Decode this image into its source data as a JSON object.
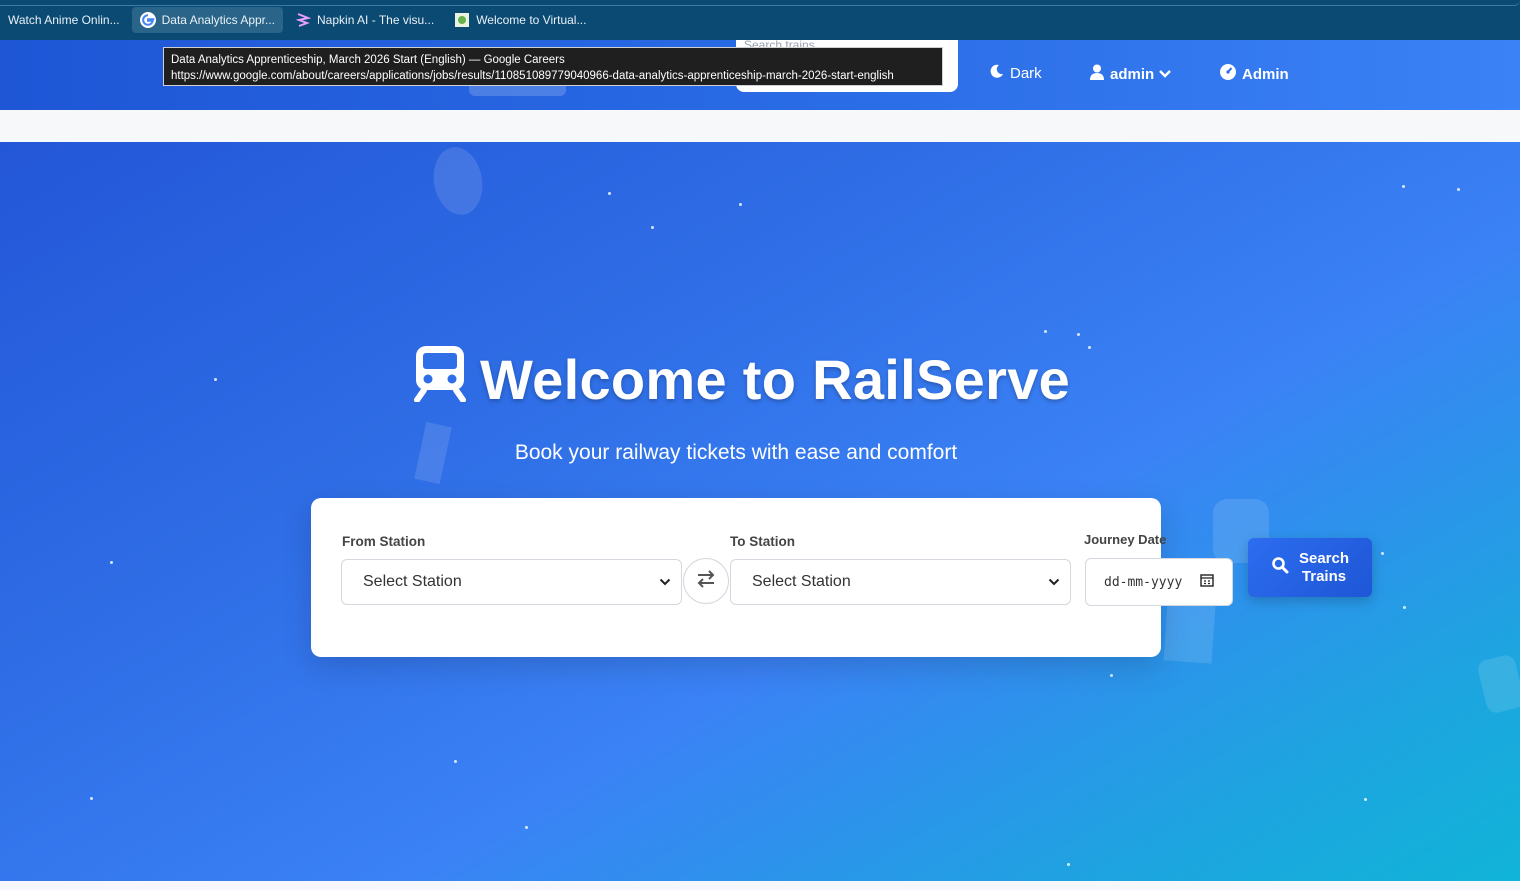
{
  "browser": {
    "bookmarks": [
      {
        "label": "Watch Anime Onlin...",
        "icon": "anime-site-icon"
      },
      {
        "label": "Data Analytics Appr...",
        "icon": "google-g-icon"
      },
      {
        "label": "Napkin AI - The visu...",
        "icon": "napkin-icon"
      },
      {
        "label": "Welcome to Virtual...",
        "icon": "virtual-site-icon"
      }
    ],
    "tooltip": {
      "title": "Data Analytics Apprenticeship, March 2026 Start (English) — Google Careers",
      "url": "https://www.google.com/about/careers/applications/jobs/results/110851089779040966-data-analytics-apprenticeship-march-2026-start-english"
    }
  },
  "nav": {
    "search_placeholder": "Search trains...",
    "theme_toggle": "Dark",
    "user_menu": "admin",
    "admin_link": "Admin"
  },
  "hero": {
    "title": "Welcome to RailServe",
    "subtitle": "Book your railway tickets with ease and comfort"
  },
  "search_form": {
    "from_label": "From Station",
    "from_value": "Select Station",
    "to_label": "To Station",
    "to_value": "Select Station",
    "date_label": "Journey Date",
    "date_placeholder": "dd-mm-yyyy",
    "submit_line1": "Search",
    "submit_line2": "Trains"
  },
  "colors": {
    "brand": "#2563eb",
    "hero_start": "#2357d8",
    "hero_end": "#10b4d8",
    "bookmarks_bg": "#0b4a72"
  }
}
